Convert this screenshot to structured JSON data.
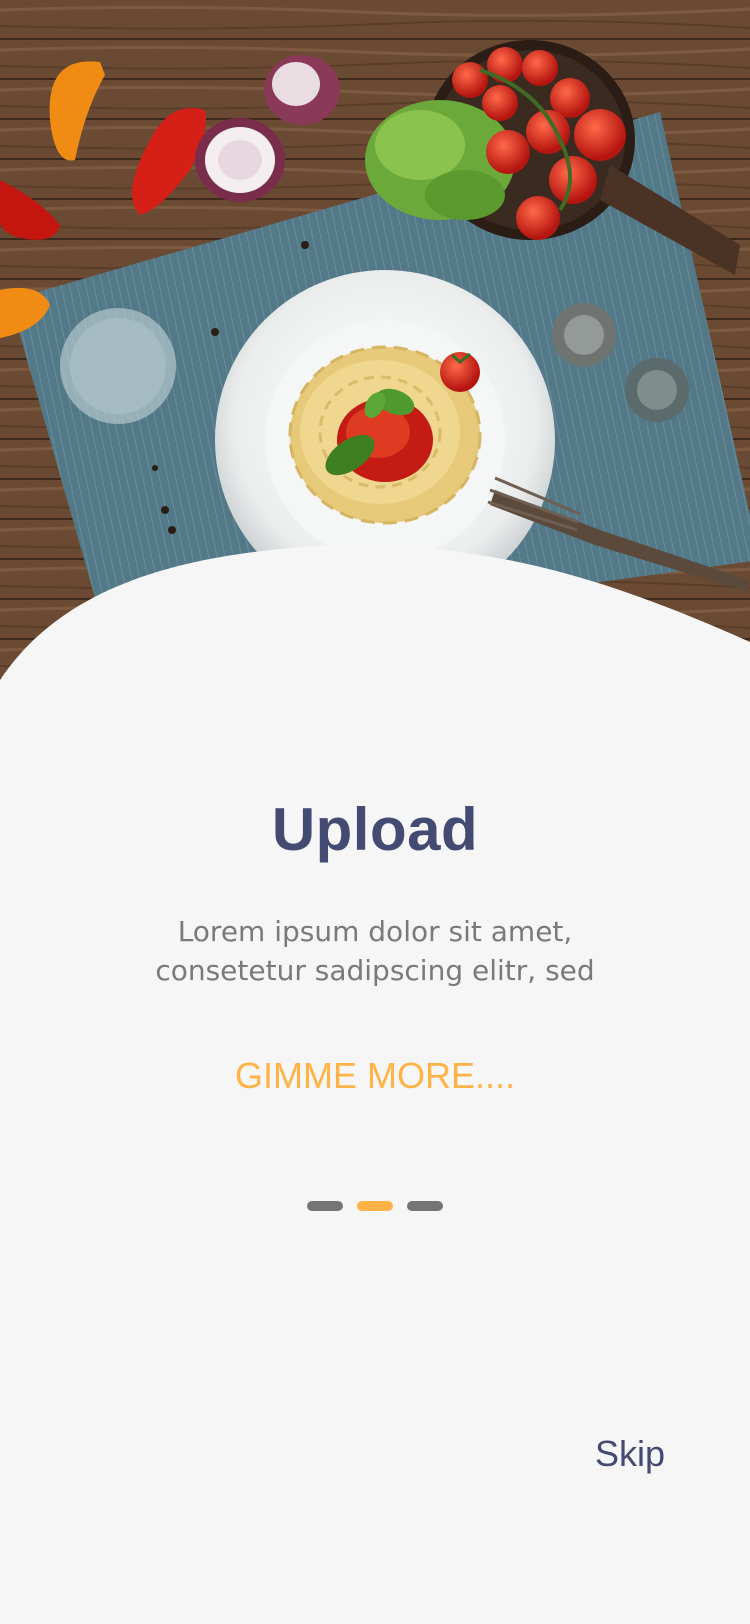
{
  "hero": {
    "image_description_icon": "pasta-flatlay-photo"
  },
  "content": {
    "title": "Upload",
    "description_lines": [
      "Lorem ipsum dolor sit amet,",
      "consetetur sadipscing elitr, sed"
    ],
    "cta_label": "GIMME MORE...."
  },
  "pager": {
    "count": 3,
    "active_index": 1
  },
  "footer": {
    "skip_label": "Skip"
  },
  "colors": {
    "background": "#f6f6f6",
    "title": "#434b73",
    "accent": "#ffb347",
    "dot_inactive": "#757575",
    "body_text": "#7a7a7a"
  }
}
